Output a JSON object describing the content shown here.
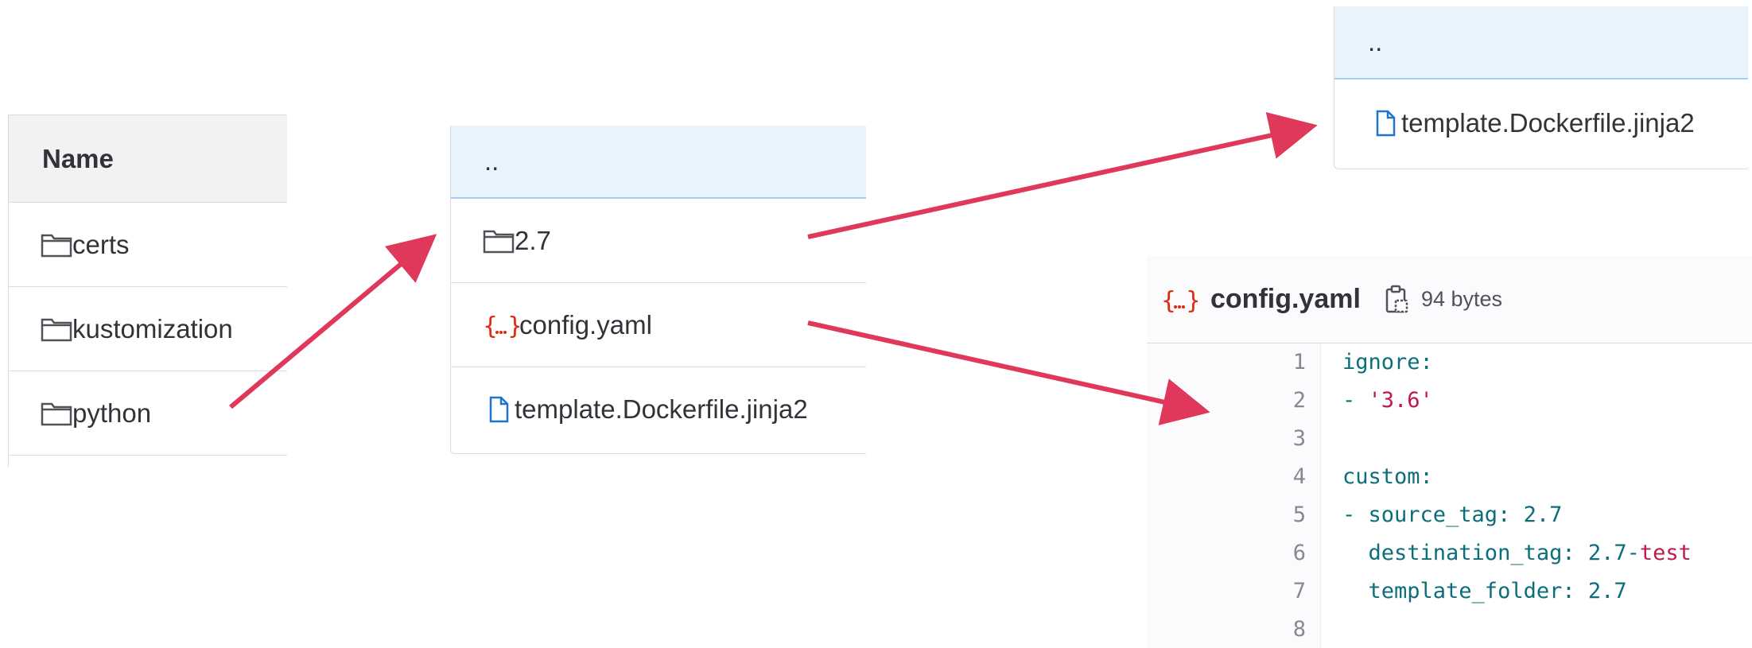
{
  "panel_root": {
    "header": "Name",
    "items": [
      {
        "icon": "folder-icon",
        "label": "certs"
      },
      {
        "icon": "folder-icon",
        "label": "kustomization"
      },
      {
        "icon": "folder-icon",
        "label": "python"
      }
    ]
  },
  "panel_python": {
    "up": "..",
    "items": [
      {
        "icon": "folder-icon",
        "label": "2.7"
      },
      {
        "icon": "yaml-icon",
        "label": "config.yaml"
      },
      {
        "icon": "file-icon",
        "label": "template.Dockerfile.jinja2"
      }
    ]
  },
  "panel_27": {
    "up": "..",
    "items": [
      {
        "icon": "file-icon",
        "label": "template.Dockerfile.jinja2"
      }
    ]
  },
  "file_viewer": {
    "icon": "yaml-icon",
    "filename": "config.yaml",
    "copy_icon": "copy-icon",
    "size": "94 bytes",
    "lines": [
      {
        "n": "1",
        "text": "ignore:"
      },
      {
        "n": "2",
        "text": "- '3.6'"
      },
      {
        "n": "3",
        "text": ""
      },
      {
        "n": "4",
        "text": "custom:"
      },
      {
        "n": "5",
        "text": "- source_tag: 2.7"
      },
      {
        "n": "6",
        "text": "  destination_tag: 2.7-test"
      },
      {
        "n": "7",
        "text": "  template_folder: 2.7"
      },
      {
        "n": "8",
        "text": ""
      }
    ]
  },
  "colors": {
    "arrow": "#e0385a",
    "folder_stroke": "#535158",
    "file_icon": "#1f75cb",
    "yaml_icon": "#dd2b0e"
  }
}
